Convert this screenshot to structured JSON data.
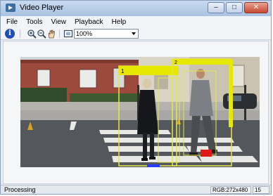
{
  "window": {
    "title": "Video Player",
    "minimize_symbol": "–",
    "maximize_symbol": "□",
    "close_symbol": "✕"
  },
  "menu": {
    "items": [
      "File",
      "Tools",
      "View",
      "Playback",
      "Help"
    ]
  },
  "toolbar": {
    "info_label": "i",
    "zoom_value": "100%",
    "icons": [
      "info-icon",
      "zoom-in-icon",
      "zoom-out-icon",
      "pan-icon",
      "fit-to-window-icon"
    ]
  },
  "video": {
    "detections": [
      {
        "label": "1"
      },
      {
        "label": "2"
      }
    ],
    "colors": {
      "box": "#e4e84a",
      "tag": "#e6e800",
      "marker_red": "#e01818",
      "marker_blue": "#2a3cff"
    }
  },
  "status": {
    "text": "Processing",
    "resolution": "RGB:272x480",
    "frame": "15"
  }
}
